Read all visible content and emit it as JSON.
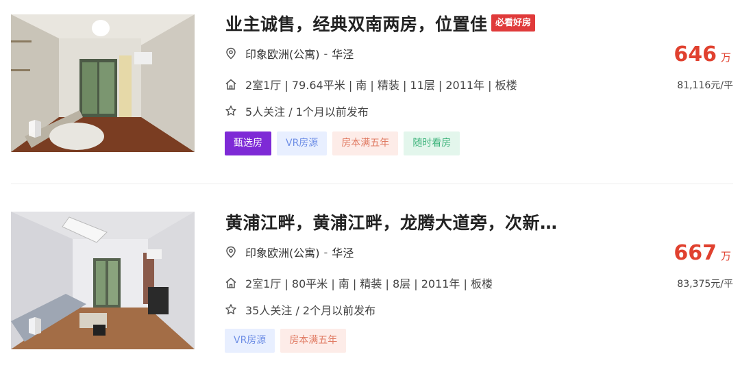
{
  "listings": [
    {
      "title": "业主诚售，经典双南两房，位置佳",
      "badge": "必看好房",
      "community": "印象欧洲(公寓)",
      "location_sep": "-",
      "district": "华泾",
      "info": "2室1厅 | 79.64平米 | 南 | 精装 | 11层 | 2011年 | 板楼",
      "follow": "5人关注 / 1个月以前发布",
      "tags": [
        "甄选房",
        "VR房源",
        "房本满五年",
        "随时看房"
      ],
      "price": "646",
      "price_unit": "万",
      "unit_price": "81,116元/平"
    },
    {
      "title": "黄浦江畔，黄浦江畔，龙腾大道旁，次新…",
      "community": "印象欧洲(公寓)",
      "location_sep": "-",
      "district": "华泾",
      "info": "2室1厅 | 80平米 | 南 | 精装 | 8层 | 2011年 | 板楼",
      "follow": "35人关注 / 2个月以前发布",
      "tags": [
        "VR房源",
        "房本满五年"
      ],
      "price": "667",
      "price_unit": "万",
      "unit_price": "83,375元/平"
    }
  ],
  "colors": {
    "price": "#e0412f",
    "badge": "#e03a3a",
    "tag_select": "#7e2ad6",
    "tag_vr": "#6f8fe6",
    "tag_five_years": "#e07a62",
    "tag_visit": "#3cb37a"
  },
  "icons": {
    "location": "location-pin-icon",
    "house": "house-icon",
    "star": "star-icon",
    "vr": "vr-icon"
  }
}
